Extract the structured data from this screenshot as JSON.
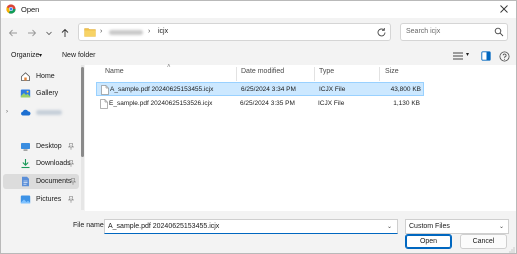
{
  "window": {
    "title": "Open"
  },
  "navigation": {
    "address": {
      "current_folder": "icjx"
    },
    "search": {
      "placeholder": "Search icjx"
    }
  },
  "toolbar": {
    "organize_label": "Organize",
    "new_folder_label": "New folder"
  },
  "sidebar": {
    "items": [
      {
        "label": "Home",
        "icon": "home-icon"
      },
      {
        "label": "Gallery",
        "icon": "gallery-icon"
      },
      {
        "label": "",
        "icon": "onedrive-icon"
      },
      {
        "label": "Desktop",
        "icon": "desktop-icon"
      },
      {
        "label": "Downloads",
        "icon": "downloads-icon"
      },
      {
        "label": "Documents",
        "icon": "documents-icon",
        "selected": true
      },
      {
        "label": "Pictures",
        "icon": "pictures-icon"
      }
    ]
  },
  "file_list": {
    "columns": [
      "Name",
      "Date modified",
      "Type",
      "Size"
    ],
    "rows": [
      {
        "name": "A_sample.pdf 20240625153455.icjx",
        "date": "6/25/2024 3:34 PM",
        "type": "ICJX File",
        "size": "43,800 KB",
        "selected": true
      },
      {
        "name": "E_sample.pdf 20240625153526.icjx",
        "date": "6/25/2024 3:35 PM",
        "type": "ICJX File",
        "size": "1,130 KB",
        "selected": false
      }
    ]
  },
  "footer": {
    "file_name_label": "File name:",
    "file_name_value": "A_sample.pdf 20240625153455.icjx",
    "file_type_value": "Custom Files",
    "open_label": "Open",
    "cancel_label": "Cancel"
  },
  "colors": {
    "accent": "#0067c0",
    "selection": "#cce8ff",
    "folder": "#f0c24b"
  }
}
